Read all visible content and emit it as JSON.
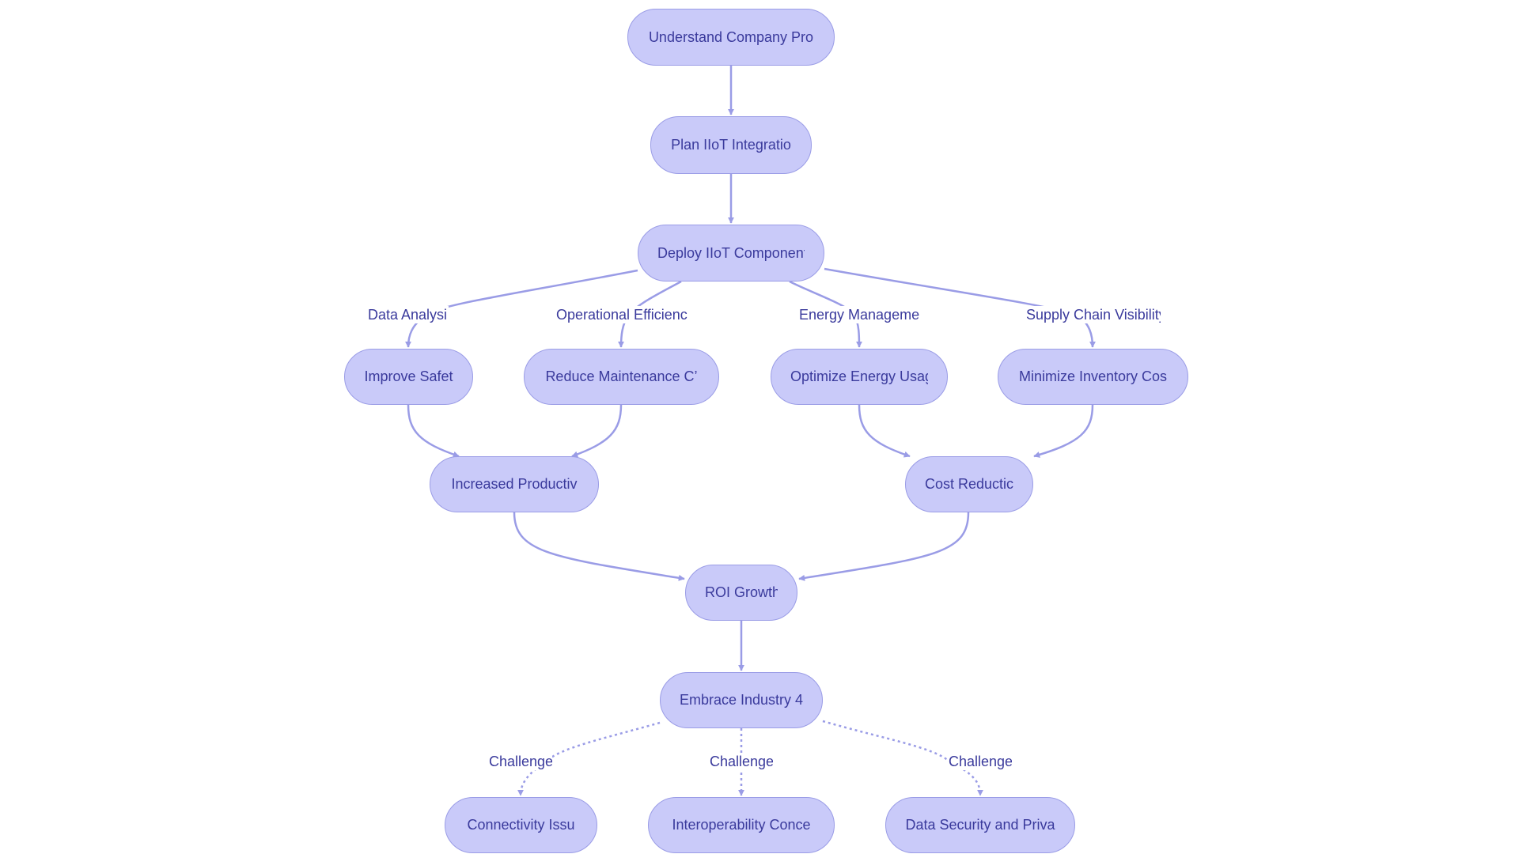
{
  "diagram": {
    "type": "flowchart",
    "colors": {
      "node_fill": "#c9caf9",
      "node_border": "#9a9ce6",
      "edge": "#9a9ce6",
      "text": "#3a3a9c"
    },
    "nodes": {
      "understand": "Understand Company Pro",
      "plan": "Plan IIoT Integratio",
      "deploy": "Deploy IIoT Component",
      "safety": "Improve Safet",
      "maintenance": "Reduce Maintenance C’",
      "energy": "Optimize Energy Usag",
      "inventory": "Minimize Inventory Cos",
      "productivity": "Increased Productiv",
      "cost": "Cost Reductic",
      "roi": "ROI Growth",
      "industry": "Embrace Industry 4",
      "connectivity": "Connectivity Issu",
      "interop": "Interoperability Conce",
      "security": "Data Security and Priva"
    },
    "edge_labels": {
      "data_analysis": "Data Analysi",
      "operational": "Operational Efficienc",
      "energy_mgmt": "Energy Manageme",
      "supply_chain": "Supply Chain Visibility",
      "challenge_1": "Challenge",
      "challenge_2": "Challenge",
      "challenge_3": "Challenge"
    },
    "edges": [
      {
        "from": "understand",
        "to": "plan",
        "style": "solid"
      },
      {
        "from": "plan",
        "to": "deploy",
        "style": "solid"
      },
      {
        "from": "deploy",
        "to": "safety",
        "label": "data_analysis",
        "style": "solid"
      },
      {
        "from": "deploy",
        "to": "maintenance",
        "label": "operational",
        "style": "solid"
      },
      {
        "from": "deploy",
        "to": "energy",
        "label": "energy_mgmt",
        "style": "solid"
      },
      {
        "from": "deploy",
        "to": "inventory",
        "label": "supply_chain",
        "style": "solid"
      },
      {
        "from": "safety",
        "to": "productivity",
        "style": "solid"
      },
      {
        "from": "maintenance",
        "to": "productivity",
        "style": "solid"
      },
      {
        "from": "energy",
        "to": "cost",
        "style": "solid"
      },
      {
        "from": "inventory",
        "to": "cost",
        "style": "solid"
      },
      {
        "from": "productivity",
        "to": "roi",
        "style": "solid"
      },
      {
        "from": "cost",
        "to": "roi",
        "style": "solid"
      },
      {
        "from": "roi",
        "to": "industry",
        "style": "solid"
      },
      {
        "from": "industry",
        "to": "connectivity",
        "label": "challenge_1",
        "style": "dotted"
      },
      {
        "from": "industry",
        "to": "interop",
        "label": "challenge_2",
        "style": "dotted"
      },
      {
        "from": "industry",
        "to": "security",
        "label": "challenge_3",
        "style": "dotted"
      }
    ]
  }
}
